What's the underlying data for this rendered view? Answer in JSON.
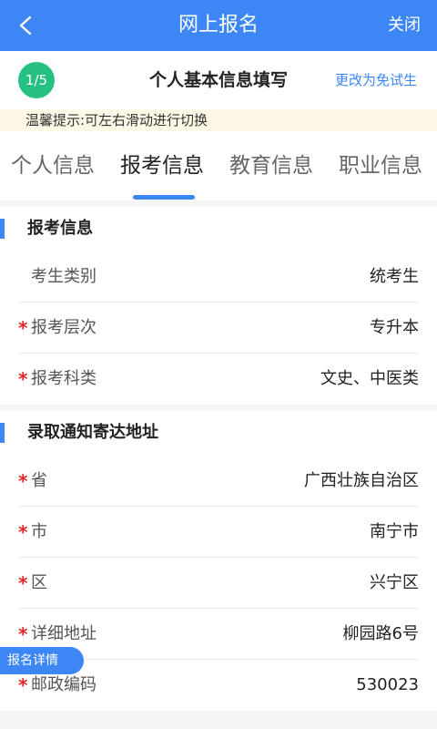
{
  "nav": {
    "back_icon": "chevron-left-icon",
    "title": "网上报名",
    "close_label": "关闭"
  },
  "step": {
    "badge": "1/5",
    "title": "个人基本信息填写",
    "switch_label": "更改为免试生"
  },
  "tip": "温馨提示:可左右滑动进行切换",
  "tabs": [
    {
      "label": "个人信息",
      "active": false
    },
    {
      "label": "报考信息",
      "active": true
    },
    {
      "label": "教育信息",
      "active": false
    },
    {
      "label": "职业信息",
      "active": false
    }
  ],
  "sections": {
    "apply": {
      "title": "报考信息",
      "rows": [
        {
          "label": "考生类别",
          "value": "统考生",
          "required": false
        },
        {
          "label": "报考层次",
          "value": "专升本",
          "required": true
        },
        {
          "label": "报考科类",
          "value": "文史、中医类",
          "required": true
        }
      ]
    },
    "address": {
      "title": "录取通知寄达地址",
      "rows": [
        {
          "label": "省",
          "value": "广西壮族自治区",
          "required": true
        },
        {
          "label": "市",
          "value": "南宁市",
          "required": true
        },
        {
          "label": "区",
          "value": "兴宁区",
          "required": true
        },
        {
          "label": "详细地址",
          "value": "柳园路6号",
          "required": true
        },
        {
          "label": "邮政编码",
          "value": "530023",
          "required": true
        }
      ]
    }
  },
  "required_mark": "*",
  "float_button": "报名详情",
  "colors": {
    "primary": "#3d86f5",
    "step_badge": "#27c082",
    "required": "#e02828",
    "tip_bg": "#fdf8e6"
  }
}
